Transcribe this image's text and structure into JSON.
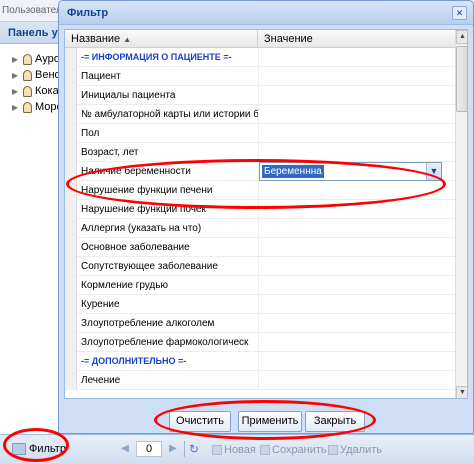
{
  "background": {
    "user_label": "Пользовател",
    "panel_title": "Панель упр",
    "tree_items": [
      "Ауро",
      "Вено",
      "Кока",
      "Море"
    ],
    "bottom_bar": {
      "filter_label": "Фильтр",
      "page_value": "0",
      "new_label": "Новая",
      "save_label": "Сохранить",
      "delete_label": "Удалить"
    }
  },
  "dialog": {
    "title": "Фильтр",
    "columns": {
      "name": "Название",
      "value": "Значение"
    },
    "rows": [
      {
        "name": "-= ИНФОРМАЦИЯ О ПАЦИЕНТЕ =-",
        "value": ""
      },
      {
        "name": "Пациент",
        "value": ""
      },
      {
        "name": "Инициалы пациента",
        "value": ""
      },
      {
        "name": "№ амбулаторной карты или истории б",
        "value": ""
      },
      {
        "name": "Пол",
        "value": ""
      },
      {
        "name": "Возраст, лет",
        "value": ""
      },
      {
        "name": "Наличие беременности",
        "value": "Беременнна"
      },
      {
        "name": "Нарушение функции печени",
        "value": ""
      },
      {
        "name": "Нарушение функции почек",
        "value": ""
      },
      {
        "name": "Аллергия (указать на что)",
        "value": ""
      },
      {
        "name": "Основное заболевание",
        "value": ""
      },
      {
        "name": "Сопутствующее заболевание",
        "value": ""
      },
      {
        "name": "Кормление грудью",
        "value": ""
      },
      {
        "name": "Курение",
        "value": ""
      },
      {
        "name": "Злоупотребление алкоголем",
        "value": ""
      },
      {
        "name": "Злоупотребление фармокологическ",
        "value": ""
      },
      {
        "name": "-= ДОПОЛНИТЕЛЬНО =-",
        "value": ""
      },
      {
        "name": "Лечение",
        "value": ""
      }
    ],
    "buttons": {
      "clear": "Очистить",
      "apply": "Применить",
      "close": "Закрыть"
    }
  },
  "annotation_color": "#ff0000"
}
